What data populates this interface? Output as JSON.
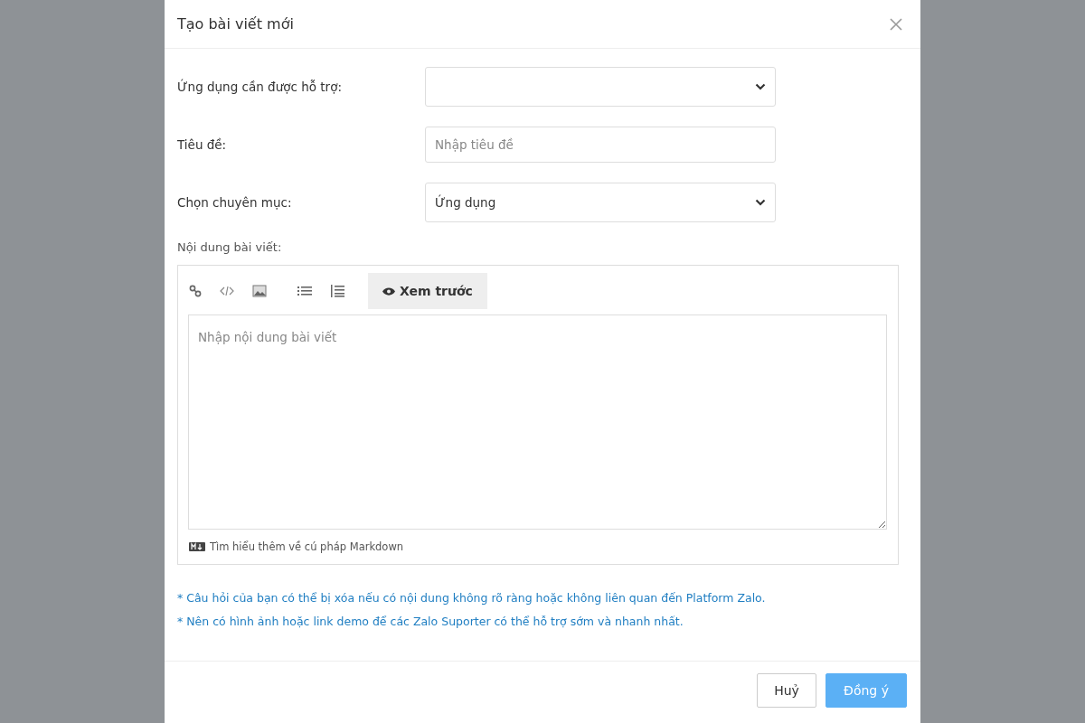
{
  "dialog": {
    "title": "Tạo bài viết mới"
  },
  "fields": [
    {
      "kind": "select",
      "label": "Ứng dụng cần được hỗ trợ:"
    },
    {
      "kind": "input",
      "label": "Tiêu đề:",
      "placeholder": "Nhập tiêu đề"
    },
    {
      "kind": "select",
      "label": "Chọn chuyên mục:",
      "value": "Ứng dụng"
    }
  ],
  "editor": {
    "label": "Nội dung bài viết:",
    "preview_button": "Xem trước",
    "placeholder": "Nhập nội dung bài viết",
    "markdown_link": "Tìm hiểu thêm về cú pháp Markdown"
  },
  "notes": [
    "* Câu hỏi của bạn có thể bị xóa nếu có nội dung không rõ ràng hoặc không liên quan đến Platform Zalo.",
    "* Nên có hình ảnh hoặc link demo để các Zalo Suporter có thể hỗ trợ sớm và nhanh nhất."
  ],
  "buttons": [
    {
      "kind": "secondary",
      "label": "Huỷ"
    },
    {
      "kind": "primary",
      "label": "Đồng ý"
    }
  ]
}
